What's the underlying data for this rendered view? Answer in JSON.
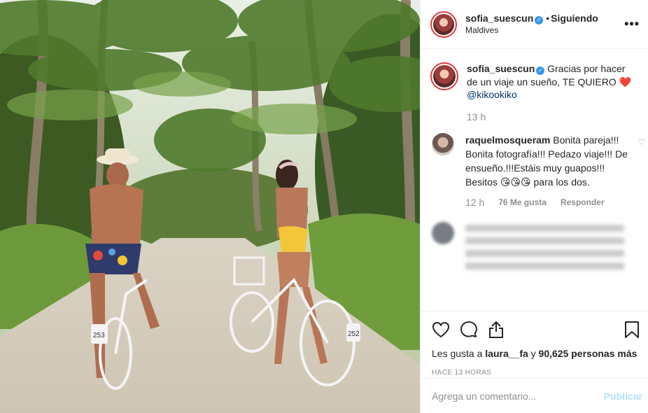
{
  "post": {
    "photo_alt": "photo-of-couple-on-bicycles",
    "bike_plate_left": "253",
    "bike_plate_right": "252"
  },
  "header": {
    "username": "sofia_suescun",
    "verified_icon": "verified-badge-icon",
    "separator": "•",
    "follow_state": "Siguiendo",
    "location": "Maldives",
    "more_icon": "•••"
  },
  "caption": {
    "username": "sofia_suescun",
    "text": "Gracias por hacer de un viaje un sueño, TE QUIERO",
    "heart": "❤️",
    "mention": "@kikookiko",
    "time": "13 h"
  },
  "comments": [
    {
      "username": "raquelmosqueram",
      "text": "Bonita pareja!!! Bonita fotografía!!! Pedazo viaje!!! De ensueño.!!!Estáis muy guapos!!! Besitos",
      "emojis": "😘😘😘",
      "text_end": "para los dos.",
      "time": "12 h",
      "likes": "76 Me gusta",
      "reply": "Responder"
    }
  ],
  "actions": {
    "likes_prefix": "Les gusta a",
    "likes_user": "laura__fa",
    "likes_mid": "y",
    "likes_count": "90,625 personas más",
    "timestamp": "HACE 13 HORAS"
  },
  "add_comment": {
    "placeholder": "Agrega un comentario...",
    "publish": "Publicar"
  },
  "colors": {
    "verified": "#3897f0",
    "border": "#efefef",
    "muted": "#8e8e8e",
    "publish_disabled": "#b2dffc",
    "mention": "#003569"
  }
}
